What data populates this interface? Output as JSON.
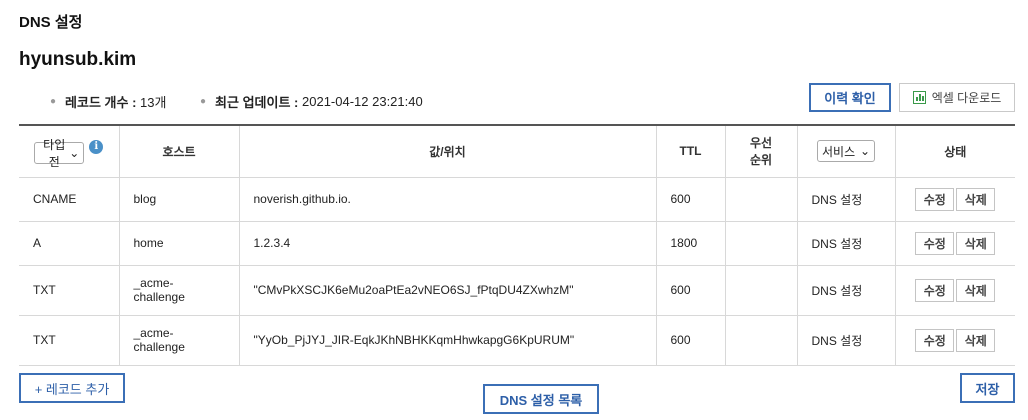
{
  "page": {
    "title": "DNS 설정",
    "domain": "hyunsub.kim"
  },
  "summary": {
    "record_count_label": "레코드 개수 :",
    "record_count_value": "13개",
    "last_update_label": "최근 업데이트 :",
    "last_update_value": "2021-04-12 23:21:40"
  },
  "actions": {
    "history_label": "이력 확인",
    "excel_label": "엑셀 다운로드",
    "add_record_label": "+ 레코드 추가",
    "dns_list_label": "DNS 설정 목록",
    "save_label": "저장"
  },
  "table": {
    "type_filter": "타입 전",
    "headers": {
      "host": "호스트",
      "value": "값/위치",
      "ttl": "TTL",
      "priority_line1": "우선",
      "priority_line2": "순위",
      "status": "상태"
    },
    "service_filter": "서비스",
    "edit_label": "수정",
    "delete_label": "삭제",
    "rows": [
      {
        "type": "CNAME",
        "host": "blog",
        "value": "noverish.github.io.",
        "ttl": "600",
        "priority": "",
        "service": "DNS 설정"
      },
      {
        "type": "A",
        "host": "home",
        "value": "1.2.3.4",
        "ttl": "1800",
        "priority": "",
        "service": "DNS 설정"
      },
      {
        "type": "TXT",
        "host_line1": "_acme-",
        "host_line2": "challenge",
        "value": "\"CMvPkXSCJK6eMu2oaPtEa2vNEO6SJ_fPtqDU4ZXwhzM\"",
        "ttl": "600",
        "priority": "",
        "service": "DNS 설정"
      },
      {
        "type": "TXT",
        "host_line1": "_acme-",
        "host_line2": "challenge",
        "value": "\"YyOb_PjJYJ_JIR-EqkJKhNBHKKqmHhwkapgG6KpURUM\"",
        "ttl": "600",
        "priority": "",
        "service": "DNS 설정"
      }
    ]
  },
  "colors": {
    "accent_blue": "#3b6fb6",
    "excel_green": "#3a9a4a",
    "info_blue": "#4a90c8"
  },
  "icons": {
    "info": "info-icon",
    "excel": "excel-icon",
    "chevron": "chevron-down-icon"
  }
}
